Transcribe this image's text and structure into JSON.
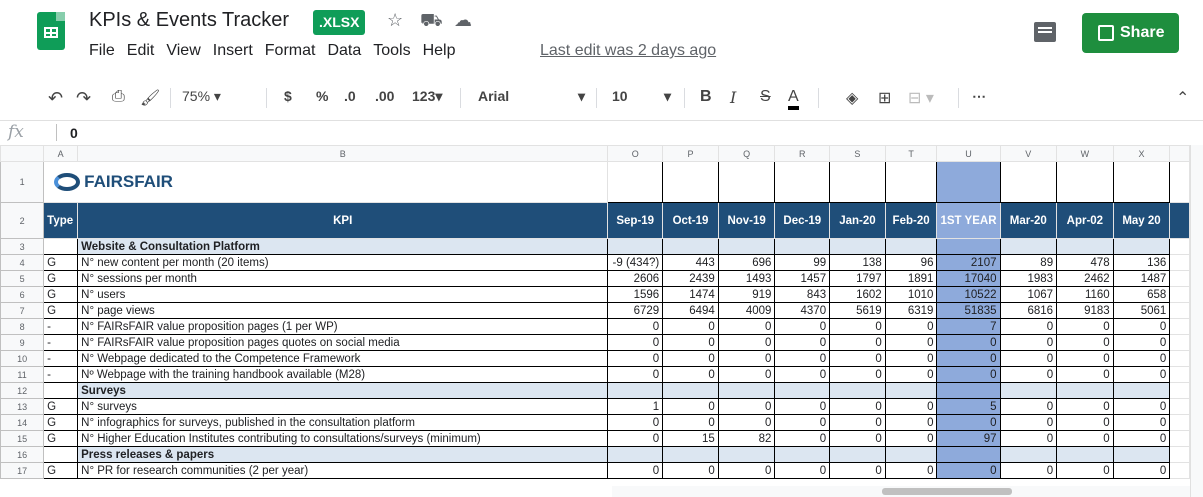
{
  "doc": {
    "title": "KPIs & Events Tracker",
    "badge": ".XLSX",
    "last_edit": "Last edit was 2 days ago",
    "share": "Share"
  },
  "menu": [
    "File",
    "Edit",
    "View",
    "Insert",
    "Format",
    "Data",
    "Tools",
    "Help"
  ],
  "toolbar": {
    "zoom": "75%",
    "currency": "$",
    "percent": "%",
    "dec_less": ".0",
    "dec_more": ".00",
    "format": "123",
    "font": "Arial",
    "size": "10",
    "bold": "B",
    "italic": "I",
    "strike": "S",
    "color": "A",
    "more": "⋯"
  },
  "formula": {
    "fx": "fx",
    "value": "0"
  },
  "logo": {
    "text": "FAIRSFAIR"
  },
  "columns": [
    "A",
    "B",
    "O",
    "P",
    "Q",
    "R",
    "S",
    "T",
    "U",
    "V",
    "W",
    "X"
  ],
  "header_row": {
    "type": "Type",
    "kpi": "KPI",
    "months": [
      "Sep-19",
      "Oct-19",
      "Nov-19",
      "Dec-19",
      "Jan-20",
      "Feb-20",
      "1ST YEAR",
      "Mar-20",
      "Apr-02",
      "May 20"
    ]
  },
  "rows": [
    {
      "n": "3",
      "section": "Website & Consultation Platform"
    },
    {
      "n": "4",
      "type": "G",
      "kpi": "N° new content per month (20 items)",
      "vals": [
        "-9 (434?)",
        "443",
        "696",
        "99",
        "138",
        "96",
        "2107",
        "89",
        "478",
        "136"
      ]
    },
    {
      "n": "5",
      "type": "G",
      "kpi": "N° sessions per month",
      "vals": [
        "2606",
        "2439",
        "1493",
        "1457",
        "1797",
        "1891",
        "17040",
        "1983",
        "2462",
        "1487"
      ]
    },
    {
      "n": "6",
      "type": "G",
      "kpi": "N° users",
      "vals": [
        "1596",
        "1474",
        "919",
        "843",
        "1602",
        "1010",
        "10522",
        "1067",
        "1160",
        "658"
      ]
    },
    {
      "n": "7",
      "type": "G",
      "kpi": "N° page views",
      "vals": [
        "6729",
        "6494",
        "4009",
        "4370",
        "5619",
        "6319",
        "51835",
        "6816",
        "9183",
        "5061"
      ]
    },
    {
      "n": "8",
      "type": "-",
      "kpi": "N° FAIRsFAIR value proposition pages (1 per WP)",
      "vals": [
        "0",
        "0",
        "0",
        "0",
        "0",
        "0",
        "7",
        "0",
        "0",
        "0"
      ]
    },
    {
      "n": "9",
      "type": "-",
      "kpi": "N° FAIRsFAIR value proposition pages quotes on social media",
      "vals": [
        "0",
        "0",
        "0",
        "0",
        "0",
        "0",
        "0",
        "0",
        "0",
        "0"
      ]
    },
    {
      "n": "10",
      "type": "-",
      "kpi": "N° Webpage dedicated to the Competence Framework",
      "vals": [
        "0",
        "0",
        "0",
        "0",
        "0",
        "0",
        "0",
        "0",
        "0",
        "0"
      ]
    },
    {
      "n": "11",
      "type": "-",
      "kpi": "Nº Webpage with the training handbook available (M28)",
      "vals": [
        "0",
        "0",
        "0",
        "0",
        "0",
        "0",
        "0",
        "0",
        "0",
        "0"
      ]
    },
    {
      "n": "12",
      "section": "Surveys"
    },
    {
      "n": "13",
      "type": "G",
      "kpi": "N° surveys",
      "vals": [
        "1",
        "0",
        "0",
        "0",
        "0",
        "0",
        "5",
        "0",
        "0",
        "0"
      ]
    },
    {
      "n": "14",
      "type": "G",
      "kpi": "N° infographics for surveys, published in the consultation platform",
      "vals": [
        "0",
        "0",
        "0",
        "0",
        "0",
        "0",
        "0",
        "0",
        "0",
        "0"
      ]
    },
    {
      "n": "15",
      "type": "G",
      "kpi": "N° Higher Education Institutes contributing to consultations/surveys (minimum)",
      "vals": [
        "0",
        "15",
        "82",
        "0",
        "0",
        "0",
        "97",
        "0",
        "0",
        "0"
      ]
    },
    {
      "n": "16",
      "section": "Press releases & papers"
    },
    {
      "n": "17",
      "type": "G",
      "kpi": "N° PR for research communities (2 per year)",
      "vals": [
        "0",
        "0",
        "0",
        "0",
        "0",
        "0",
        "0",
        "0",
        "0",
        "0"
      ]
    }
  ]
}
